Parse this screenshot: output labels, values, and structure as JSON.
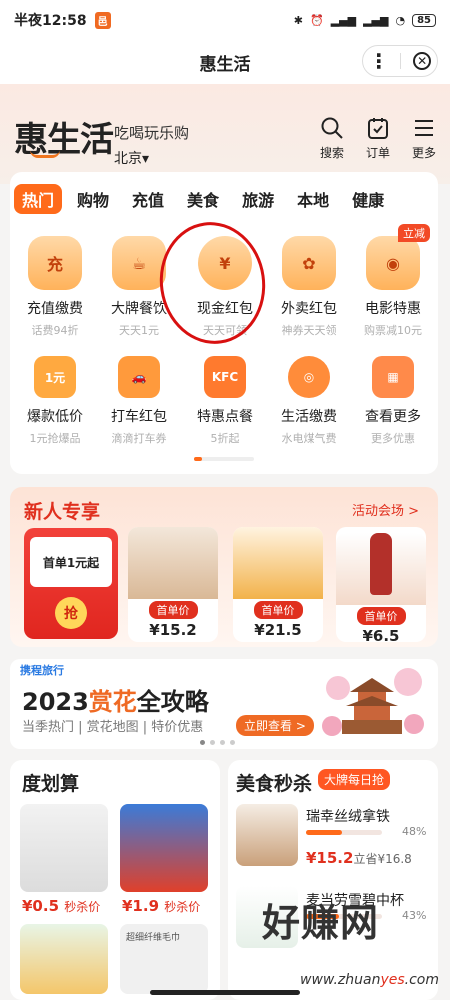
{
  "status": {
    "time": "半夜12:58",
    "app_badge": "邑",
    "battery": "85"
  },
  "appbar": {
    "title": "惠生活"
  },
  "header": {
    "logo": "惠生活",
    "slogan": "吃喝玩乐购",
    "city": "北京▾",
    "actions": [
      {
        "label": "搜索",
        "icon": "search-icon"
      },
      {
        "label": "订单",
        "icon": "order-icon"
      },
      {
        "label": "更多",
        "icon": "menu-icon"
      }
    ]
  },
  "tabs": [
    "热门",
    "购物",
    "充值",
    "美食",
    "旅游",
    "本地",
    "健康"
  ],
  "grid_row1": [
    {
      "label": "充值缴费",
      "sub": "话费94折",
      "glyph": "充"
    },
    {
      "label": "大牌餐饮",
      "sub": "天天1元",
      "glyph": "☕"
    },
    {
      "label": "现金红包",
      "sub": "天天可领",
      "glyph": "¥"
    },
    {
      "label": "外卖红包",
      "sub": "神券天天领",
      "glyph": "✿"
    },
    {
      "label": "电影特惠",
      "sub": "购票减10元",
      "glyph": "◉"
    }
  ],
  "grid_badge": "立减",
  "grid_row2": [
    {
      "label": "爆款低价",
      "sub": "1元抢爆品",
      "glyph": "1元",
      "color": "#ffa940"
    },
    {
      "label": "打车红包",
      "sub": "滴滴打车券",
      "glyph": "🚗",
      "color": "#ff9a3c"
    },
    {
      "label": "特惠点餐",
      "sub": "5折起",
      "glyph": "KFC",
      "color": "#ff7a2e"
    },
    {
      "label": "生活缴费",
      "sub": "水电煤气费",
      "glyph": "◎",
      "color": "#ff8c3a"
    },
    {
      "label": "查看更多",
      "sub": "更多优惠",
      "glyph": "▦",
      "color": "#ff8a4a"
    }
  ],
  "xinren": {
    "title": "新人专享",
    "link": "活动会场 >",
    "envelope_text": "首单1元起",
    "envelope_btn": "抢",
    "products": [
      {
        "badge": "首单价",
        "price": "¥15.2",
        "color": "#d9b896"
      },
      {
        "badge": "首单价",
        "price": "¥21.5",
        "color": "#f2b24a"
      },
      {
        "badge": "首单价",
        "price": "¥6.5",
        "color": "#b3302a"
      }
    ]
  },
  "ctrip": {
    "brand": "携程旅行",
    "title_pre": "2023",
    "title_hl": "赏花",
    "title_post": "全攻略",
    "sub": "当季热门 | 赏花地图 | 特价优惠",
    "btn": "立即查看 >"
  },
  "duhuasuan": {
    "title": "度划算",
    "items": [
      {
        "price": "¥0.5",
        "tag": "秒杀价"
      },
      {
        "price": "¥1.9",
        "tag": "秒杀价"
      }
    ],
    "tile_text": "超细纤维毛巾"
  },
  "meishi": {
    "title": "美食秒杀",
    "badge": "大牌每日抢",
    "items": [
      {
        "name": "瑞幸丝绒拿铁",
        "pct": "48%",
        "pct_value": 0.48,
        "price": "¥15.2",
        "orig": "立省¥16.8"
      },
      {
        "name": "麦当劳雪碧中杯",
        "pct": "43%",
        "pct_value": 0.43
      }
    ]
  },
  "watermark": {
    "text": "好赚网",
    "url_pre": "www.zhuan",
    "url_hl": "yes",
    "url_post": ".com"
  }
}
